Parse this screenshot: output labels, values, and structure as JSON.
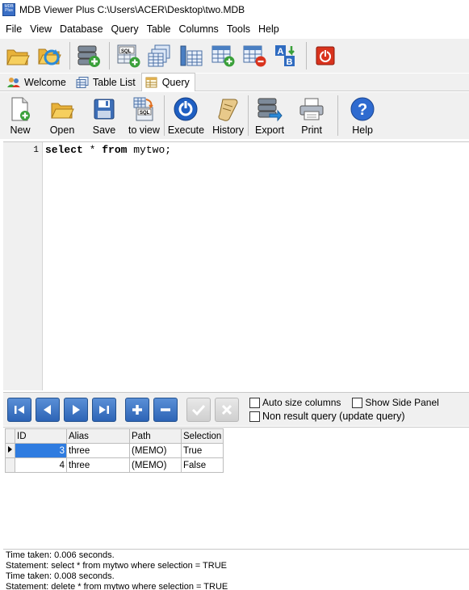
{
  "window": {
    "title": "MDB Viewer Plus C:\\Users\\ACER\\Desktop\\two.MDB",
    "app_icon_text": "MDB Plus"
  },
  "menu": [
    "File",
    "View",
    "Database",
    "Query",
    "Table",
    "Columns",
    "Tools",
    "Help"
  ],
  "main_toolbar": {
    "icons": [
      "open-folder-icon",
      "refresh-folder-icon",
      "add-database-icon",
      "sql-query-icon",
      "tables-icon",
      "table-columns-icon",
      "add-table-icon",
      "remove-table-icon",
      "sort-ab-icon",
      "exit-icon"
    ]
  },
  "tabs": [
    {
      "label": "Welcome",
      "icon": "people-icon"
    },
    {
      "label": "Table List",
      "icon": "table-list-icon"
    },
    {
      "label": "Query",
      "icon": "query-tab-icon",
      "active": true
    }
  ],
  "query_toolbar": [
    {
      "label": "New",
      "icon": "new-document-icon"
    },
    {
      "label": "Open",
      "icon": "open-folder-icon"
    },
    {
      "label": "Save",
      "icon": "floppy-disk-icon"
    },
    {
      "label": "to view",
      "icon": "sql-to-view-icon"
    },
    {
      "label": "Execute",
      "icon": "execute-icon"
    },
    {
      "label": "History",
      "icon": "history-scroll-icon"
    },
    {
      "label": "Export",
      "icon": "export-icon"
    },
    {
      "label": "Print",
      "icon": "printer-icon"
    },
    {
      "label": "Help",
      "icon": "help-icon"
    }
  ],
  "editor": {
    "line_number": "1",
    "kw1": "select",
    "star": " * ",
    "kw2": "from",
    "rest": " mytwo;"
  },
  "nav_options": {
    "auto_size": "Auto size columns",
    "show_side_panel": "Show Side Panel",
    "non_result": "Non result query (update query)"
  },
  "grid": {
    "columns": [
      "ID",
      "Alias",
      "Path",
      "Selection"
    ],
    "rows": [
      [
        "3",
        "three",
        "(MEMO)",
        "True"
      ],
      [
        "4",
        "three",
        "(MEMO)",
        "False"
      ]
    ]
  },
  "log": [
    "Time taken: 0.006 seconds.",
    "Statement: select * from mytwo where selection = TRUE",
    "Time taken: 0.008 seconds.",
    "Statement: delete * from mytwo where selection = TRUE"
  ],
  "colors": {
    "accent_blue": "#2f7ce0",
    "execute_blue": "#1f5fc2",
    "exit_red": "#d9331d"
  }
}
